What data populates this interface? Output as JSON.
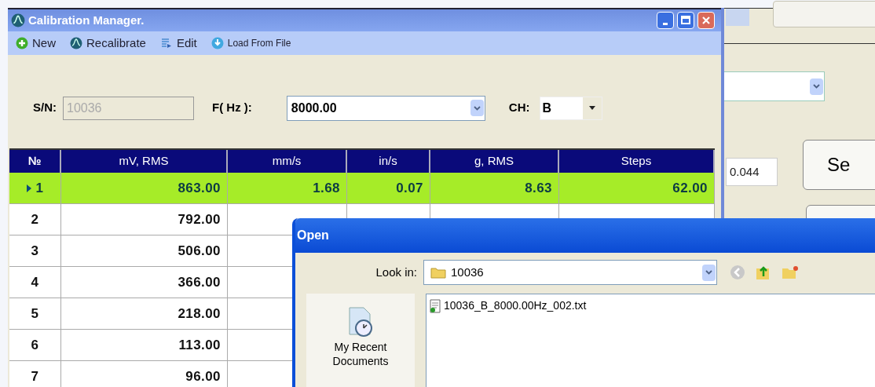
{
  "window": {
    "title": "Calibration Manager."
  },
  "toolbar": [
    {
      "label": "New",
      "kind": "new"
    },
    {
      "label": "Recalibrate",
      "kind": "recalibrate"
    },
    {
      "label": "Edit",
      "kind": "edit"
    },
    {
      "label": "Load From File",
      "kind": "load"
    }
  ],
  "form": {
    "sn_label": "S/N:",
    "sn_value": "10036",
    "sn_disabled": true,
    "freq_label": "F( Hz ):",
    "freq_value": "8000.00",
    "ch_label": "CH:",
    "ch_value": "B"
  },
  "table": {
    "columns": [
      "№",
      "mV, RMS",
      "mm/s",
      "in/s",
      "g, RMS",
      "Steps"
    ],
    "rows": [
      {
        "cells": [
          "1",
          "863.00",
          "1.68",
          "0.07",
          "8.63",
          "62.00"
        ],
        "selected": true
      },
      {
        "cells": [
          "2",
          "792.00"
        ],
        "selected": false
      },
      {
        "cells": [
          "3",
          "506.00"
        ],
        "selected": false
      },
      {
        "cells": [
          "4",
          "366.00"
        ],
        "selected": false
      },
      {
        "cells": [
          "5",
          "218.00"
        ],
        "selected": false
      },
      {
        "cells": [
          "6",
          "113.00"
        ],
        "selected": false
      },
      {
        "cells": [
          "7",
          "96.00"
        ],
        "selected": false
      }
    ]
  },
  "background_panel": {
    "value": "0.044",
    "button": "Se"
  },
  "open_dialog": {
    "title": "Open",
    "look_in_label": "Look in:",
    "look_in_value": "10036",
    "places": [
      {
        "label": "My Recent Documents"
      }
    ],
    "files": [
      "10036_B_8000.00Hz_002.txt"
    ]
  }
}
